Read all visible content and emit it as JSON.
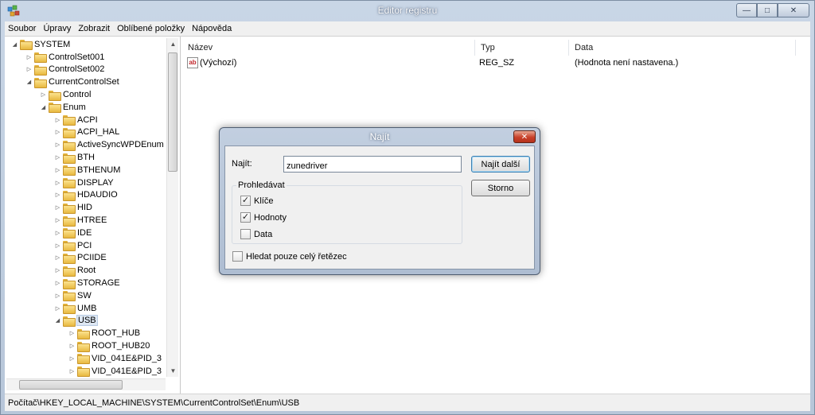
{
  "window": {
    "title": "Editor registru"
  },
  "menu": [
    "Soubor",
    "Úpravy",
    "Zobrazit",
    "Oblíbené položky",
    "Nápověda"
  ],
  "tree": [
    {
      "label": "SYSTEM",
      "depth": 0,
      "open": true
    },
    {
      "label": "ControlSet001",
      "depth": 1,
      "open": false
    },
    {
      "label": "ControlSet002",
      "depth": 1,
      "open": false
    },
    {
      "label": "CurrentControlSet",
      "depth": 1,
      "open": true
    },
    {
      "label": "Control",
      "depth": 2,
      "open": false
    },
    {
      "label": "Enum",
      "depth": 2,
      "open": true
    },
    {
      "label": "ACPI",
      "depth": 3,
      "open": false
    },
    {
      "label": "ACPI_HAL",
      "depth": 3,
      "open": false
    },
    {
      "label": "ActiveSyncWPDEnum",
      "depth": 3,
      "open": false
    },
    {
      "label": "BTH",
      "depth": 3,
      "open": false
    },
    {
      "label": "BTHENUM",
      "depth": 3,
      "open": false
    },
    {
      "label": "DISPLAY",
      "depth": 3,
      "open": false
    },
    {
      "label": "HDAUDIO",
      "depth": 3,
      "open": false
    },
    {
      "label": "HID",
      "depth": 3,
      "open": false
    },
    {
      "label": "HTREE",
      "depth": 3,
      "open": false
    },
    {
      "label": "IDE",
      "depth": 3,
      "open": false
    },
    {
      "label": "PCI",
      "depth": 3,
      "open": false
    },
    {
      "label": "PCIIDE",
      "depth": 3,
      "open": false
    },
    {
      "label": "Root",
      "depth": 3,
      "open": false
    },
    {
      "label": "STORAGE",
      "depth": 3,
      "open": false
    },
    {
      "label": "SW",
      "depth": 3,
      "open": false
    },
    {
      "label": "UMB",
      "depth": 3,
      "open": false
    },
    {
      "label": "USB",
      "depth": 3,
      "open": true,
      "selected": true
    },
    {
      "label": "ROOT_HUB",
      "depth": 4,
      "open": false
    },
    {
      "label": "ROOT_HUB20",
      "depth": 4,
      "open": false
    },
    {
      "label": "VID_041E&PID_3",
      "depth": 4,
      "open": false
    },
    {
      "label": "VID_041E&PID_3",
      "depth": 4,
      "open": false
    }
  ],
  "list": {
    "headers": {
      "name": "Název",
      "type": "Typ",
      "data": "Data"
    },
    "rows": [
      {
        "icon": "string-value-icon",
        "icon_text": "ab",
        "name": "(Výchozí)",
        "type": "REG_SZ",
        "data": "(Hodnota není nastavena.)"
      }
    ]
  },
  "status": "Počítač\\HKEY_LOCAL_MACHINE\\SYSTEM\\CurrentControlSet\\Enum\\USB",
  "dialog": {
    "title": "Najít",
    "close_symbol": "✕",
    "find_label": "Najít:",
    "find_value": "zunedriver",
    "find_next": "Najít další",
    "cancel": "Storno",
    "group_title": "Prohledávat",
    "options": [
      {
        "label": "Klíče",
        "checked": true
      },
      {
        "label": "Hodnoty",
        "checked": true
      },
      {
        "label": "Data",
        "checked": false
      }
    ],
    "whole_string": {
      "label": "Hledat pouze celý řetězec",
      "checked": false
    }
  },
  "titlebar_buttons": {
    "minimize": "—",
    "maximize": "□",
    "close": "✕"
  },
  "colors": {
    "selection": "#dde7f3",
    "folder": "#e8b940",
    "dialog_close": "#c8412a"
  }
}
